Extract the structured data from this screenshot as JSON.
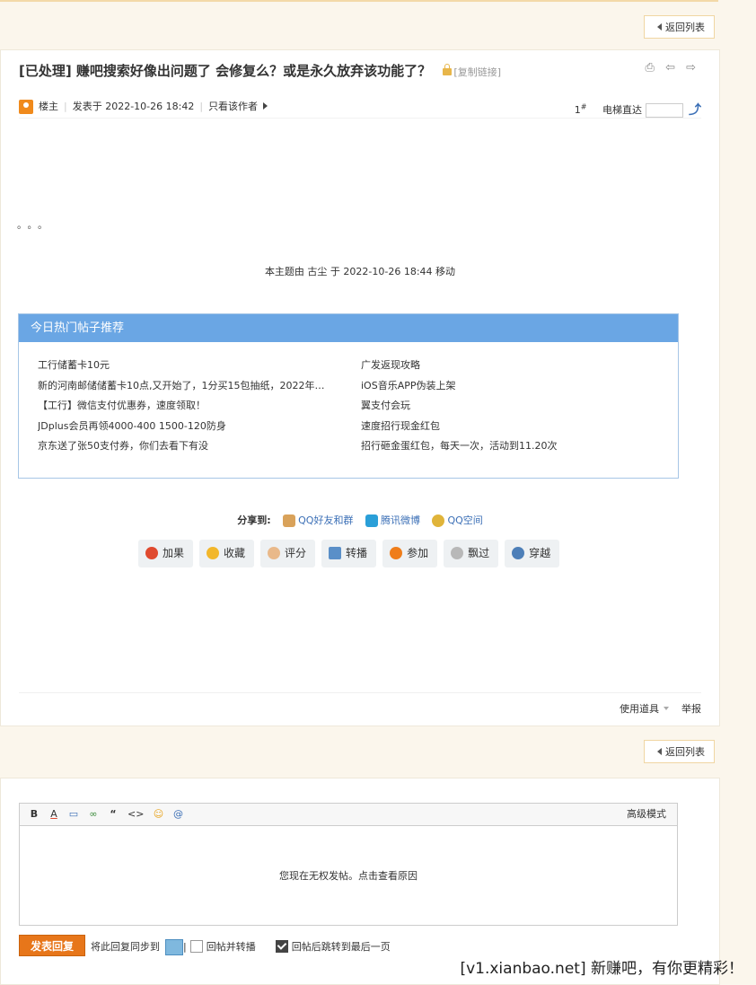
{
  "nav": {
    "back_label": "返回列表"
  },
  "post": {
    "title": "[已处理] 赚吧搜索好像出问题了 会修复么？或是永久放弃该功能了？",
    "copy_link": "[复制链接]",
    "tools": "⎙ ⇦ ⇨",
    "author_role": "楼主",
    "posted_at": "发表于 2022-10-26 18:42",
    "only_author": "只看该作者",
    "floor": "1",
    "floor_mark": "#",
    "elevator_label": "电梯直达",
    "content": "。。。",
    "mod_note": "本主题由 古尘 于 2022-10-26 18:44 移动"
  },
  "hot": {
    "title": "今日热门帖子推荐",
    "left": [
      "工行储蓄卡10元",
      "新的河南邮储储蓄卡10点,又开始了，1分买15包抽纸，2022年…",
      "【工行】微信支付优惠券，速度领取！",
      "JDplus会员再领4000-400 1500-120防身",
      "京东送了张50支付券，你们去看下有没"
    ],
    "right": [
      "广发返现攻略",
      "iOS音乐APP伪装上架",
      "翼支付会玩",
      "速度招行现金红包",
      "招行砸金蛋红包，每天一次，活动到11.20次"
    ]
  },
  "share": {
    "label": "分享到:",
    "targets": [
      "QQ好友和群",
      "腾讯微博",
      "QQ空间"
    ]
  },
  "actions": [
    "加果",
    "收藏",
    "评分",
    "转播",
    "参加",
    "飘过",
    "穿越"
  ],
  "footer": {
    "tools": "使用道具",
    "report": "举报"
  },
  "editor": {
    "toolbar": [
      "B",
      "A",
      "▭",
      "∞",
      "“",
      "<>",
      "☺",
      "@"
    ],
    "advanced_mode": "高级模式",
    "no_permission": "您现在无权发帖。点击查看原因",
    "submit": "发表回复",
    "sync_label": "将此回复同步到",
    "sync_sep": "|",
    "reply_and_forward": "回帖并转播",
    "jump_last": "回帖后跳转到最后一页"
  },
  "watermark": "[v1.xianbao.net] 新赚吧，有你更精彩！",
  "colors": {
    "accent": "#e7761a",
    "hot_header": "#6aa6e4",
    "link": "#3b6fb6"
  }
}
